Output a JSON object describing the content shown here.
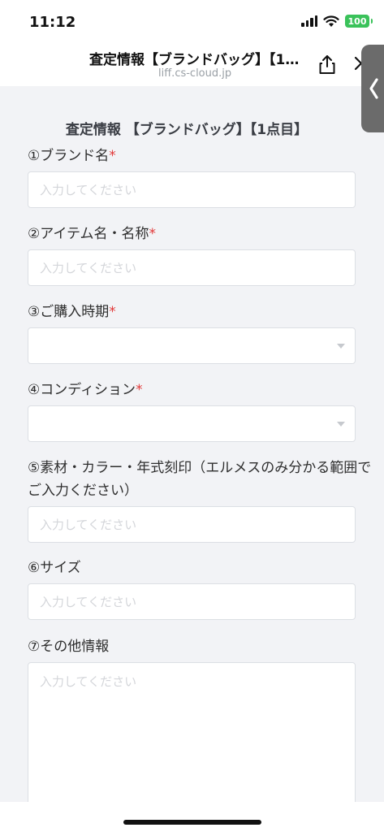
{
  "status_bar": {
    "time": "11:12",
    "battery": "100",
    "icons": [
      "signal-icon",
      "wifi-icon",
      "battery-icon"
    ]
  },
  "header": {
    "title": "査定情報【ブランドバッグ】【1…",
    "domain": "liff.cs-cloud.jp",
    "icons": [
      "share-icon",
      "close-icon",
      "chevron-left-icon"
    ]
  },
  "form": {
    "heading": "査定情報 【ブランドバッグ】【1点目】",
    "required_mark": "*",
    "fields": [
      {
        "label": "①ブランド名",
        "required": true,
        "type": "text",
        "value": "",
        "placeholder": "入力してください"
      },
      {
        "label": "②アイテム名・名称",
        "required": true,
        "type": "text",
        "value": "",
        "placeholder": "入力してください"
      },
      {
        "label": "③ご購入時期",
        "required": true,
        "type": "select",
        "value": ""
      },
      {
        "label": "④コンディション",
        "required": true,
        "type": "select",
        "value": ""
      },
      {
        "label": "⑤素材・カラー・年式刻印（エルメスのみ分かる範囲でご入力ください）",
        "required": false,
        "type": "text",
        "value": "",
        "placeholder": "入力してください"
      },
      {
        "label": "⑥サイズ",
        "required": false,
        "type": "text",
        "value": "",
        "placeholder": "入力してください"
      },
      {
        "label": "⑦その他情報",
        "required": false,
        "type": "textarea",
        "value": "",
        "placeholder": "入力してください"
      }
    ]
  },
  "colors": {
    "background": "#f2f3f6",
    "required": "#e23a3a",
    "battery": "#3ac25a"
  }
}
